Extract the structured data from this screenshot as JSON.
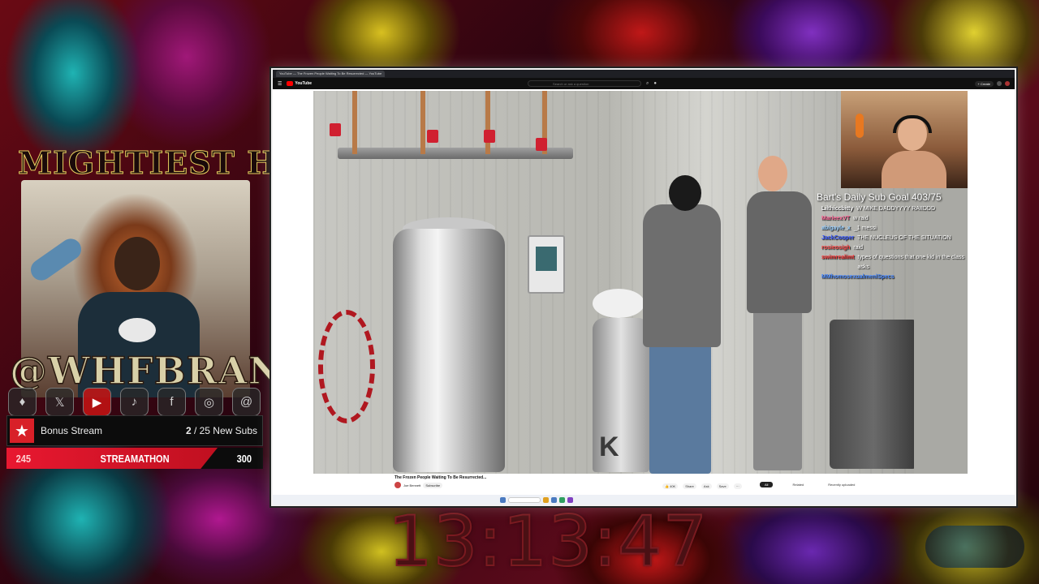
{
  "overlay": {
    "channel_logo_text": "MIGHTIEST HERO",
    "handle": "@WHFBRAND",
    "socials": [
      {
        "icon": "twitch-icon",
        "glyph": "♦"
      },
      {
        "icon": "x-icon",
        "glyph": "𝕏"
      },
      {
        "icon": "youtube-icon",
        "glyph": "▶"
      },
      {
        "icon": "tiktok-icon",
        "glyph": "♪"
      },
      {
        "icon": "facebook-icon",
        "glyph": "f"
      },
      {
        "icon": "instagram-icon",
        "glyph": "◎"
      },
      {
        "icon": "threads-icon",
        "glyph": "@"
      }
    ],
    "bonus": {
      "label": "Bonus Stream",
      "current": "2",
      "goal_text": " / 25 New Subs"
    },
    "streamathon": {
      "low": "245",
      "label": "STREAMATHON",
      "high": "300"
    },
    "timer": "13:13:47"
  },
  "browser": {
    "tabs": [
      {
        "label": "YouTube — The Frozen People Waiting To Be Resurrected — YouTube",
        "active": true
      }
    ],
    "youtube_logo": "YouTube",
    "search_placeholder": "Search or ask a question",
    "create_label": "+ Create",
    "video_title": "The Frozen People Waiting To Be Resurrected...",
    "channel_name": "Joe Bennett",
    "subscribe_label": "Subscribe",
    "actions": [
      "👍 40K",
      "Share",
      "Ask",
      "Save",
      "···"
    ],
    "side_tabs": [
      {
        "label": "All",
        "active": true
      },
      {
        "label": "Related",
        "active": false
      },
      {
        "label": "Recently uploaded",
        "active": false
      }
    ]
  },
  "stream_chat": {
    "goal": "Bart's Daily Sub Goal 403/75",
    "messages": [
      {
        "user": "Lilthiccbitty",
        "text": "W MIKE DADDYYYY RAIIDDD",
        "color": "#ffffff"
      },
      {
        "user": "MarieexVT",
        "text": "w raid",
        "color": "#ff6a9a"
      },
      {
        "user": "abigayle_x",
        "text": "_1 messi",
        "color": "#9ad0ff"
      },
      {
        "user": "JackCooper",
        "text": "THE NUCLEUS OF THE SITUATION",
        "color": "#3a5aff"
      },
      {
        "user": "rosieosigh",
        "text": "raid",
        "color": "#ff4a4a"
      },
      {
        "user": "swimrealimt",
        "text": "types of questions that one kid in the class asks",
        "color": "#ff3a3a"
      },
      {
        "user": "MMhomosexualmenlSpecs",
        "text": "",
        "color": "#4a8aff"
      }
    ]
  }
}
